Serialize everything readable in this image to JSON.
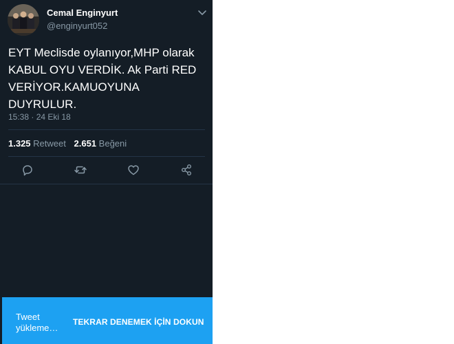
{
  "tweet": {
    "author": {
      "display_name": "Cemal Enginyurt",
      "handle": "@enginyurt052",
      "avatar_icon": "profile-photo"
    },
    "text": "EYT Meclisde oylanıyor,MHP olarak KABUL OYU VERDİK. Ak Parti RED VERİYOR.KAMUOYUNA DUYRULUR.",
    "timestamp": "15:38 · 24 Eki 18",
    "stats": {
      "retweets_count": "1.325",
      "retweets_label": "Retweet",
      "likes_count": "2.651",
      "likes_label": "Beğeni"
    },
    "actions": [
      "reply-icon",
      "retweet-icon",
      "like-icon",
      "share-icon"
    ],
    "menu_icon": "chevron-down-icon"
  },
  "snackbar": {
    "message": "Tweet yükleme…",
    "action_label": "TEKRAR DENEMEK İÇİN DOKUN"
  },
  "colors": {
    "background": "#141d26",
    "divider": "#243447",
    "secondary_text": "#8899a6",
    "icon": "#8899a6",
    "snackbar": "#1da1f2"
  }
}
